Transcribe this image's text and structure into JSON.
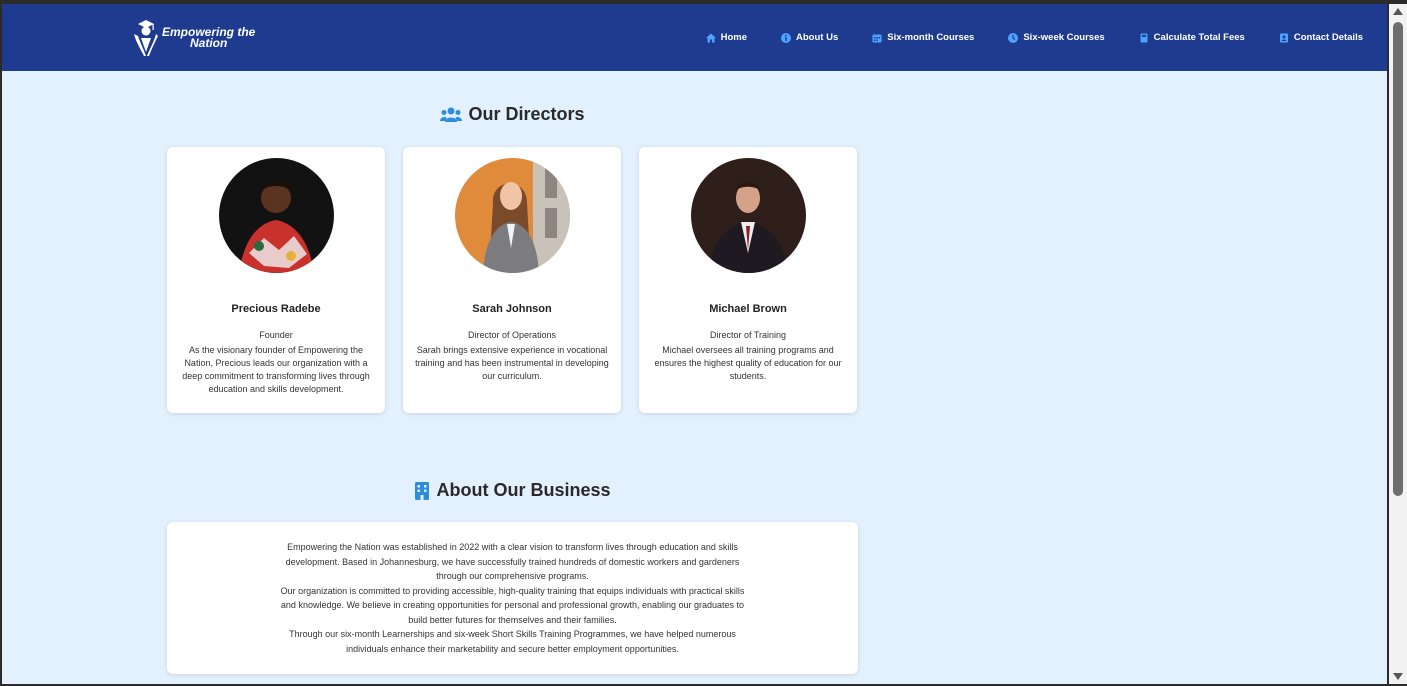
{
  "nav": {
    "brand": {
      "line1": "Empowering the",
      "line2": "Nation"
    },
    "links": [
      {
        "label": "Home",
        "icon": "home-icon"
      },
      {
        "label": "About Us",
        "icon": "info-icon"
      },
      {
        "label": "Six-month Courses",
        "icon": "calendar-icon"
      },
      {
        "label": "Six-week Courses",
        "icon": "clock-icon"
      },
      {
        "label": "Calculate Total Fees",
        "icon": "calculator-icon"
      },
      {
        "label": "Contact Details",
        "icon": "contact-icon"
      }
    ]
  },
  "directors": {
    "title": "Our Directors",
    "people": [
      {
        "name": "Precious Radebe",
        "role": "Founder",
        "description": "As the visionary founder of Empowering the Nation, Precious leads our organization with a deep commitment to transforming lives through education and skills development."
      },
      {
        "name": "Sarah Johnson",
        "role": "Director of Operations",
        "description": "Sarah brings extensive experience in vocational training and has been instrumental in developing our curriculum."
      },
      {
        "name": "Michael Brown",
        "role": "Director of Training",
        "description": "Michael oversees all training programs and ensures the highest quality of education for our students."
      }
    ]
  },
  "about": {
    "title": "About Our Business",
    "paragraphs": [
      "Empowering the Nation was established in 2022 with a clear vision to transform lives through education and skills development. Based in Johannesburg, we have successfully trained hundreds of domestic workers and gardeners through our comprehensive programs.",
      "Our organization is committed to providing accessible, high-quality training that equips individuals with practical skills and knowledge. We believe in creating opportunities for personal and professional growth, enabling our graduates to build better futures for themselves and their families.",
      "Through our six-month Learnerships and six-week Short Skills Training Programmes, we have helped numerous individuals enhance their marketability and secure better employment opportunities."
    ]
  },
  "colors": {
    "nav_bg": "#1e3b8f",
    "page_bg": "#e3f0fd",
    "accent_icon": "#2d8be0"
  }
}
